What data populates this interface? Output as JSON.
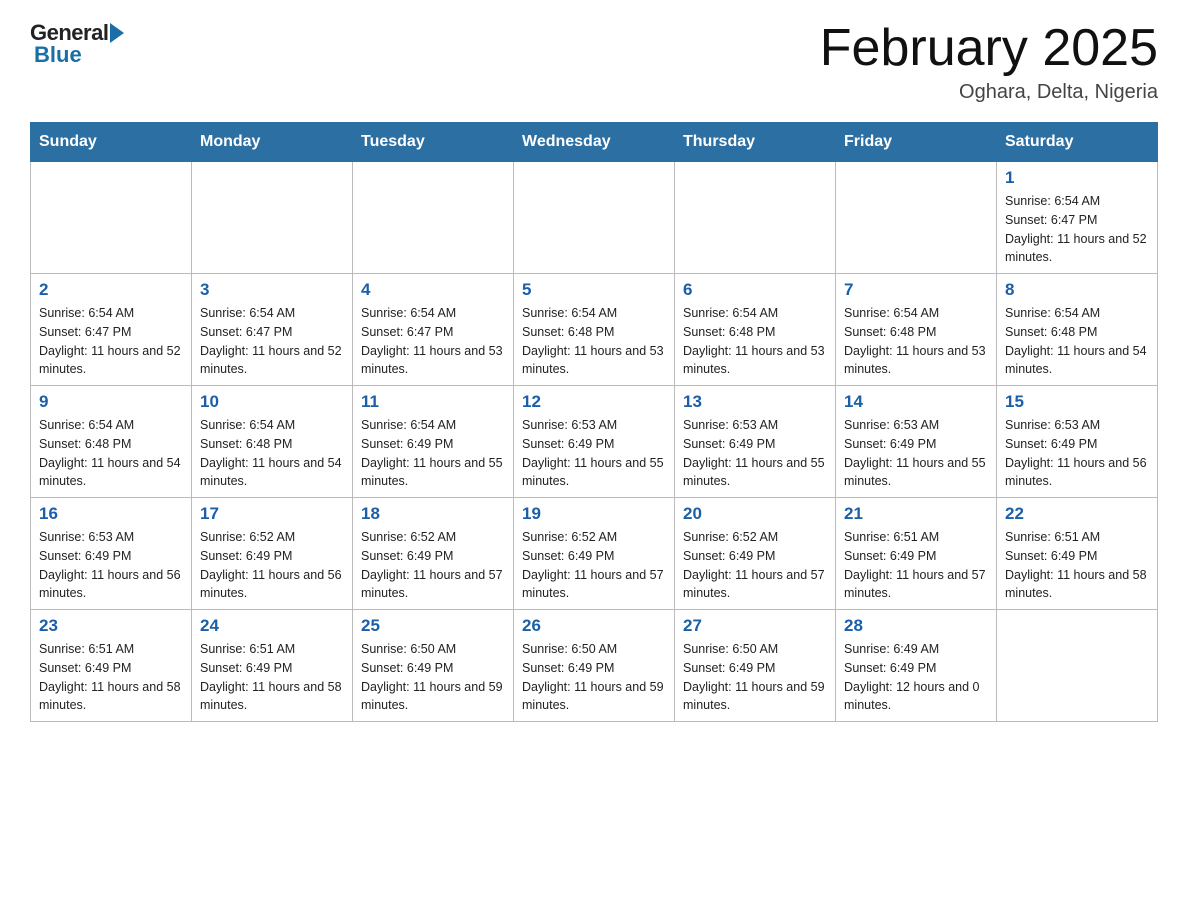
{
  "header": {
    "logo_general": "General",
    "logo_blue": "Blue",
    "title": "February 2025",
    "subtitle": "Oghara, Delta, Nigeria"
  },
  "weekdays": [
    "Sunday",
    "Monday",
    "Tuesday",
    "Wednesday",
    "Thursday",
    "Friday",
    "Saturday"
  ],
  "weeks": [
    [
      {
        "day": "",
        "sunrise": "",
        "sunset": "",
        "daylight": ""
      },
      {
        "day": "",
        "sunrise": "",
        "sunset": "",
        "daylight": ""
      },
      {
        "day": "",
        "sunrise": "",
        "sunset": "",
        "daylight": ""
      },
      {
        "day": "",
        "sunrise": "",
        "sunset": "",
        "daylight": ""
      },
      {
        "day": "",
        "sunrise": "",
        "sunset": "",
        "daylight": ""
      },
      {
        "day": "",
        "sunrise": "",
        "sunset": "",
        "daylight": ""
      },
      {
        "day": "1",
        "sunrise": "Sunrise: 6:54 AM",
        "sunset": "Sunset: 6:47 PM",
        "daylight": "Daylight: 11 hours and 52 minutes."
      }
    ],
    [
      {
        "day": "2",
        "sunrise": "Sunrise: 6:54 AM",
        "sunset": "Sunset: 6:47 PM",
        "daylight": "Daylight: 11 hours and 52 minutes."
      },
      {
        "day": "3",
        "sunrise": "Sunrise: 6:54 AM",
        "sunset": "Sunset: 6:47 PM",
        "daylight": "Daylight: 11 hours and 52 minutes."
      },
      {
        "day": "4",
        "sunrise": "Sunrise: 6:54 AM",
        "sunset": "Sunset: 6:47 PM",
        "daylight": "Daylight: 11 hours and 53 minutes."
      },
      {
        "day": "5",
        "sunrise": "Sunrise: 6:54 AM",
        "sunset": "Sunset: 6:48 PM",
        "daylight": "Daylight: 11 hours and 53 minutes."
      },
      {
        "day": "6",
        "sunrise": "Sunrise: 6:54 AM",
        "sunset": "Sunset: 6:48 PM",
        "daylight": "Daylight: 11 hours and 53 minutes."
      },
      {
        "day": "7",
        "sunrise": "Sunrise: 6:54 AM",
        "sunset": "Sunset: 6:48 PM",
        "daylight": "Daylight: 11 hours and 53 minutes."
      },
      {
        "day": "8",
        "sunrise": "Sunrise: 6:54 AM",
        "sunset": "Sunset: 6:48 PM",
        "daylight": "Daylight: 11 hours and 54 minutes."
      }
    ],
    [
      {
        "day": "9",
        "sunrise": "Sunrise: 6:54 AM",
        "sunset": "Sunset: 6:48 PM",
        "daylight": "Daylight: 11 hours and 54 minutes."
      },
      {
        "day": "10",
        "sunrise": "Sunrise: 6:54 AM",
        "sunset": "Sunset: 6:48 PM",
        "daylight": "Daylight: 11 hours and 54 minutes."
      },
      {
        "day": "11",
        "sunrise": "Sunrise: 6:54 AM",
        "sunset": "Sunset: 6:49 PM",
        "daylight": "Daylight: 11 hours and 55 minutes."
      },
      {
        "day": "12",
        "sunrise": "Sunrise: 6:53 AM",
        "sunset": "Sunset: 6:49 PM",
        "daylight": "Daylight: 11 hours and 55 minutes."
      },
      {
        "day": "13",
        "sunrise": "Sunrise: 6:53 AM",
        "sunset": "Sunset: 6:49 PM",
        "daylight": "Daylight: 11 hours and 55 minutes."
      },
      {
        "day": "14",
        "sunrise": "Sunrise: 6:53 AM",
        "sunset": "Sunset: 6:49 PM",
        "daylight": "Daylight: 11 hours and 55 minutes."
      },
      {
        "day": "15",
        "sunrise": "Sunrise: 6:53 AM",
        "sunset": "Sunset: 6:49 PM",
        "daylight": "Daylight: 11 hours and 56 minutes."
      }
    ],
    [
      {
        "day": "16",
        "sunrise": "Sunrise: 6:53 AM",
        "sunset": "Sunset: 6:49 PM",
        "daylight": "Daylight: 11 hours and 56 minutes."
      },
      {
        "day": "17",
        "sunrise": "Sunrise: 6:52 AM",
        "sunset": "Sunset: 6:49 PM",
        "daylight": "Daylight: 11 hours and 56 minutes."
      },
      {
        "day": "18",
        "sunrise": "Sunrise: 6:52 AM",
        "sunset": "Sunset: 6:49 PM",
        "daylight": "Daylight: 11 hours and 57 minutes."
      },
      {
        "day": "19",
        "sunrise": "Sunrise: 6:52 AM",
        "sunset": "Sunset: 6:49 PM",
        "daylight": "Daylight: 11 hours and 57 minutes."
      },
      {
        "day": "20",
        "sunrise": "Sunrise: 6:52 AM",
        "sunset": "Sunset: 6:49 PM",
        "daylight": "Daylight: 11 hours and 57 minutes."
      },
      {
        "day": "21",
        "sunrise": "Sunrise: 6:51 AM",
        "sunset": "Sunset: 6:49 PM",
        "daylight": "Daylight: 11 hours and 57 minutes."
      },
      {
        "day": "22",
        "sunrise": "Sunrise: 6:51 AM",
        "sunset": "Sunset: 6:49 PM",
        "daylight": "Daylight: 11 hours and 58 minutes."
      }
    ],
    [
      {
        "day": "23",
        "sunrise": "Sunrise: 6:51 AM",
        "sunset": "Sunset: 6:49 PM",
        "daylight": "Daylight: 11 hours and 58 minutes."
      },
      {
        "day": "24",
        "sunrise": "Sunrise: 6:51 AM",
        "sunset": "Sunset: 6:49 PM",
        "daylight": "Daylight: 11 hours and 58 minutes."
      },
      {
        "day": "25",
        "sunrise": "Sunrise: 6:50 AM",
        "sunset": "Sunset: 6:49 PM",
        "daylight": "Daylight: 11 hours and 59 minutes."
      },
      {
        "day": "26",
        "sunrise": "Sunrise: 6:50 AM",
        "sunset": "Sunset: 6:49 PM",
        "daylight": "Daylight: 11 hours and 59 minutes."
      },
      {
        "day": "27",
        "sunrise": "Sunrise: 6:50 AM",
        "sunset": "Sunset: 6:49 PM",
        "daylight": "Daylight: 11 hours and 59 minutes."
      },
      {
        "day": "28",
        "sunrise": "Sunrise: 6:49 AM",
        "sunset": "Sunset: 6:49 PM",
        "daylight": "Daylight: 12 hours and 0 minutes."
      },
      {
        "day": "",
        "sunrise": "",
        "sunset": "",
        "daylight": ""
      }
    ]
  ]
}
